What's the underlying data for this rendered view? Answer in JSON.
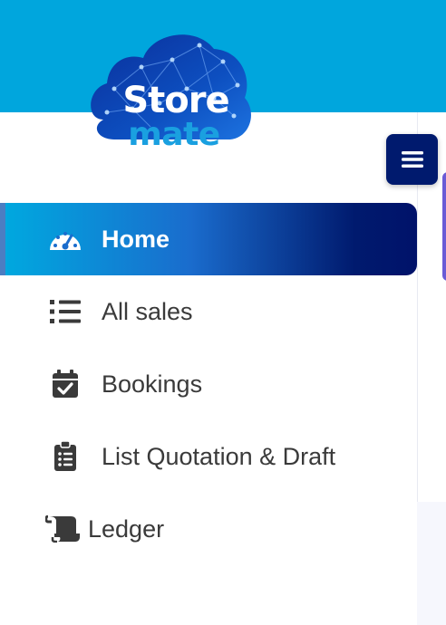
{
  "brand": {
    "line1": "Store",
    "line2": "mate",
    "colors": {
      "header": "#00a6dd",
      "navy": "#001a6e"
    }
  },
  "menu_toggle": {
    "icon": "hamburger-icon"
  },
  "nav": {
    "items": [
      {
        "label": "Home",
        "icon": "dashboard-gauge-icon",
        "active": true
      },
      {
        "label": "All sales",
        "icon": "list-icon",
        "active": false
      },
      {
        "label": "Bookings",
        "icon": "calendar-check-icon",
        "active": false
      },
      {
        "label": "List Quotation & Draft",
        "icon": "clipboard-list-icon",
        "active": false
      },
      {
        "label": "Ledger",
        "icon": "scroll-icon",
        "active": false
      }
    ]
  }
}
